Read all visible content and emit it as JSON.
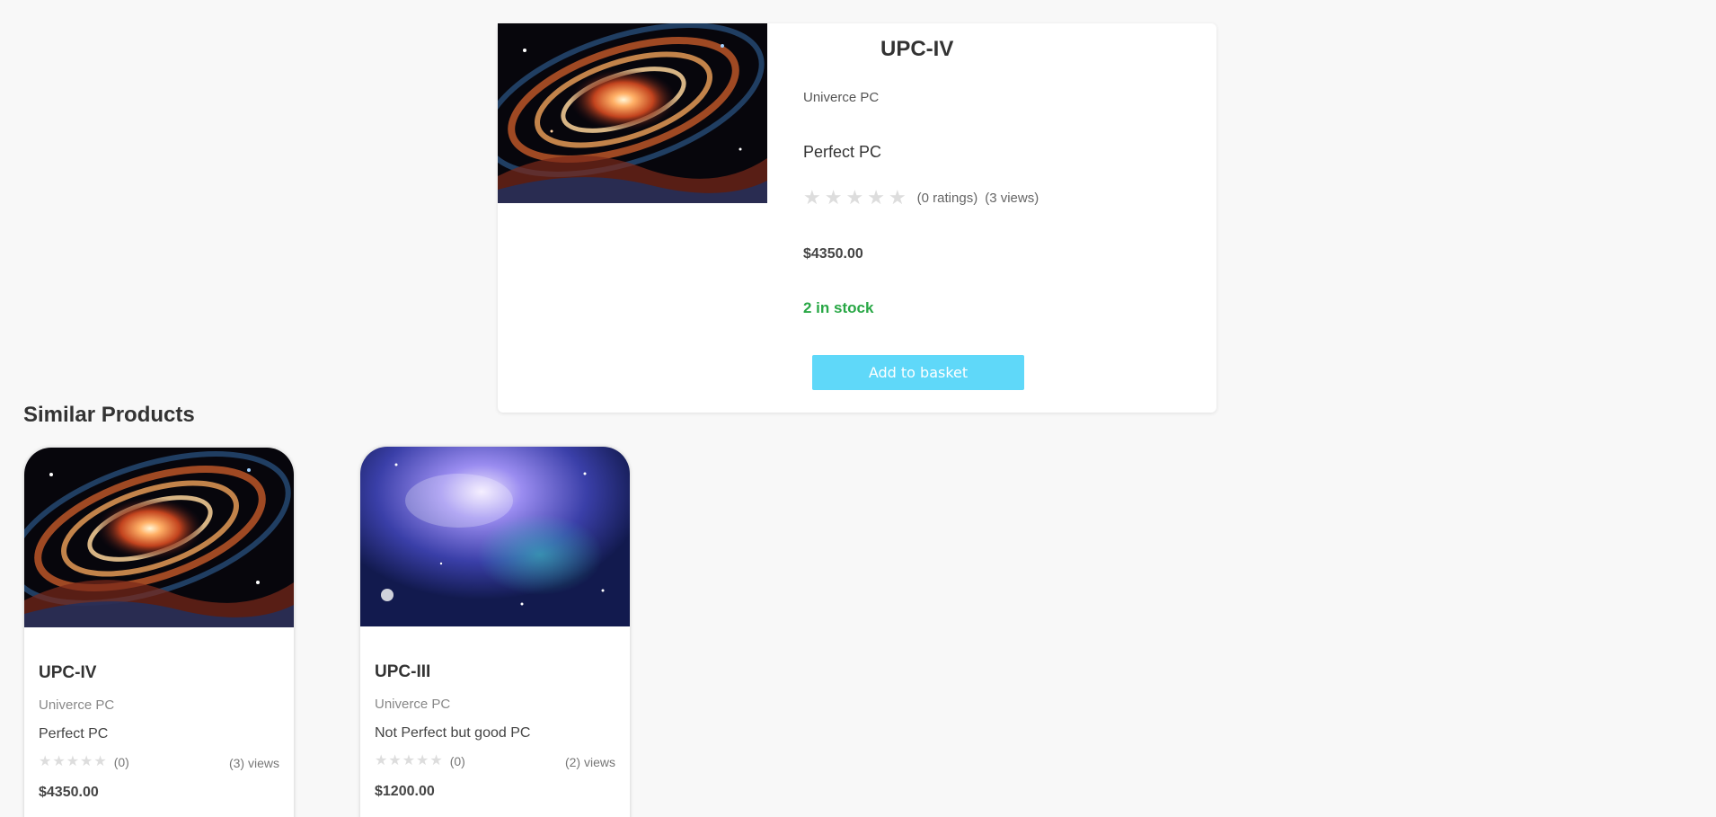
{
  "product": {
    "title": "UPC-IV",
    "brand": "Univerce PC",
    "description": "Perfect PC",
    "ratings_text": "(0 ratings)",
    "views_text": "(3 views)",
    "rating": 0,
    "price": "$4350.00",
    "stock": "2 in stock",
    "add_to_basket_label": "Add to basket",
    "image": "galaxy-spiral-image"
  },
  "similar": {
    "heading": "Similar Products",
    "items": [
      {
        "title": "UPC-IV",
        "brand": "Univerce PC",
        "description": "Perfect PC",
        "rating_count": "(0)",
        "views": "(3) views",
        "price": "$4350.00",
        "image": "galaxy-spiral-image"
      },
      {
        "title": "UPC-III",
        "brand": "Univerce PC",
        "description": "Not Perfect but good PC",
        "rating_count": "(0)",
        "views": "(2) views",
        "price": "$1200.00",
        "image": "blue-nebula-image"
      }
    ]
  },
  "colors": {
    "accent_button": "#5fd8f9",
    "stock_green": "#28a745",
    "star_empty": "#dddddd",
    "background": "#f8f8f8"
  }
}
